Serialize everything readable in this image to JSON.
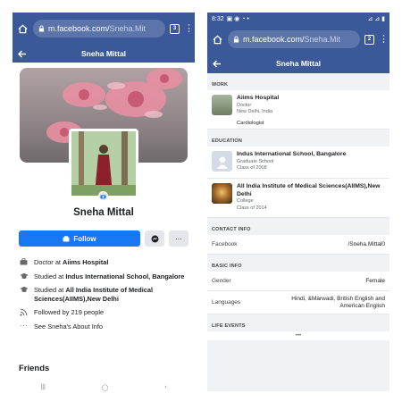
{
  "left_phone": {
    "url_host": "m.facebook.com/",
    "url_path": "Sneha.Mit",
    "tab_count": "3",
    "page_title": "Sneha Mittal",
    "profile_name": "Sneha Mittal",
    "follow_label": "Follow",
    "more_label": "···",
    "details": [
      {
        "prefix": "Doctor at ",
        "bold": "Aiims Hospital",
        "icon": "briefcase-icon"
      },
      {
        "prefix": "Studied at ",
        "bold": "Indus International School, Bangalore",
        "icon": "graduation-cap-icon"
      },
      {
        "prefix": "Studied at ",
        "bold": "All India Institute of Medical Sciences(AIIMS),New Delhi",
        "icon": "graduation-cap-icon"
      },
      {
        "prefix": "Followed by 219 people",
        "bold": "",
        "icon": "rss-icon"
      },
      {
        "prefix": "See Sneha's About Info",
        "bold": "",
        "icon": "more-dots-icon"
      }
    ],
    "friends_heading": "Friends"
  },
  "right_phone": {
    "status_time": "8:32",
    "url_host": "m.facebook.com/",
    "url_path": "Sneha.Mit",
    "tab_count": "2",
    "page_title": "Sneha Mittal",
    "work_heading": "WORK",
    "work": {
      "title": "Aiims Hospital",
      "role": "Doctor",
      "location": "New Delhi, India",
      "note": "Cardiologist"
    },
    "education_heading": "EDUCATION",
    "education": [
      {
        "title": "Indus International School, Bangalore",
        "type": "Graduate School",
        "year": "Class of 2008"
      },
      {
        "title": "All India Institute of Medical Sciences(AIIMS),New Delhi",
        "type": "College",
        "year": "Class of 2014"
      }
    ],
    "contact_heading": "CONTACT INFO",
    "contact": {
      "label": "Facebook",
      "value": "/Sneha.Mittal0"
    },
    "basic_heading": "BASIC INFO",
    "basic": [
      {
        "label": "Gender",
        "value": "Female"
      },
      {
        "label": "Languages",
        "value": "Hindi, &Marwadi, British English and American English"
      }
    ],
    "life_heading": "LIFE EVENTS",
    "life_more": "•••"
  },
  "colors": {
    "fb_blue": "#3b5998",
    "follow_blue": "#1877f2"
  }
}
